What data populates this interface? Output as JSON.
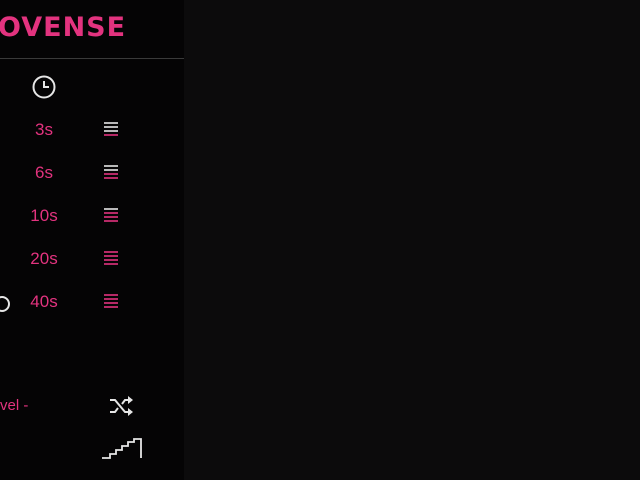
{
  "app": {
    "logo_text": "OVENSE"
  },
  "timer": {
    "icon": "clock-icon",
    "options": [
      {
        "label": "3s",
        "icon": "list-icon"
      },
      {
        "label": "6s",
        "icon": "list-icon"
      },
      {
        "label": "10s",
        "icon": "list-icon"
      },
      {
        "label": "20s",
        "icon": "list-icon"
      },
      {
        "label": "40s",
        "icon": "list-icon"
      }
    ]
  },
  "controls": {
    "level_label": "vel -",
    "shuffle_icon": "shuffle-icon",
    "steps_icon": "stairs-icon"
  },
  "colors": {
    "accent": "#e3337f",
    "icon": "#e6e6e6",
    "panel_bg": "#050405"
  }
}
